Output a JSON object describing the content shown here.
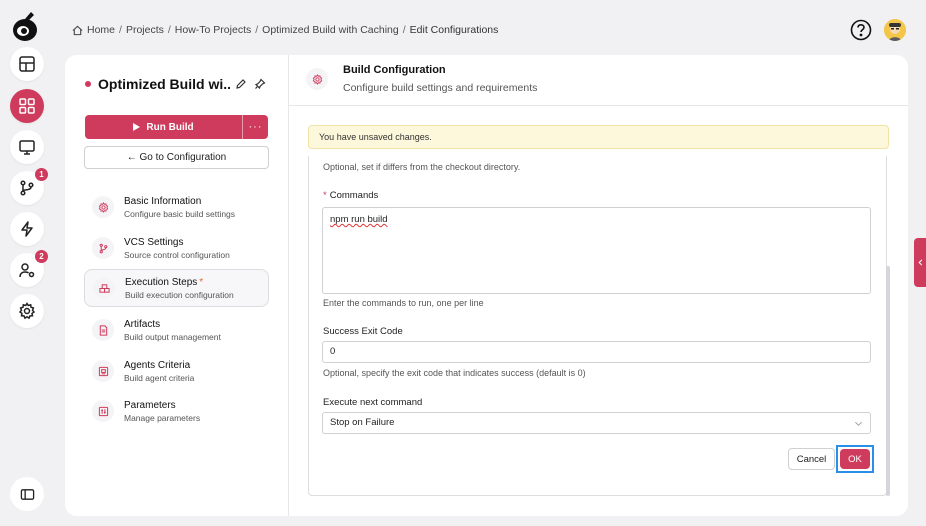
{
  "breadcrumb": {
    "items": [
      "Home",
      "Projects",
      "How-To Projects",
      "Optimized Build with Caching"
    ],
    "current": "Edit Configurations"
  },
  "rail": {
    "items": [
      {
        "icon": "dashboard-icon"
      },
      {
        "icon": "grid-icon",
        "active": true
      },
      {
        "icon": "monitor-icon"
      },
      {
        "icon": "branch-icon",
        "badge": "1"
      },
      {
        "icon": "bolt-icon"
      },
      {
        "icon": "user-gear-icon",
        "badge": "2"
      },
      {
        "icon": "settings-icon"
      }
    ]
  },
  "sidebar": {
    "title": "Optimized Build wi...",
    "run_label": "Run Build",
    "more_label": "···",
    "goto_label": "← Go to Configuration",
    "nav": [
      {
        "title": "Basic Information",
        "subtitle": "Configure basic build settings"
      },
      {
        "title": "VCS Settings",
        "subtitle": "Source control configuration"
      },
      {
        "title": "Execution Steps",
        "subtitle": "Build execution configuration",
        "required": "*"
      },
      {
        "title": "Artifacts",
        "subtitle": "Build output management"
      },
      {
        "title": "Agents Criteria",
        "subtitle": "Build agent criteria"
      },
      {
        "title": "Parameters",
        "subtitle": "Manage parameters"
      }
    ]
  },
  "content": {
    "title": "Build Configuration",
    "subtitle": "Configure build settings and requirements",
    "warning": "You have unsaved changes.",
    "form": {
      "checkout_hint": "Optional, set if differs from the checkout directory.",
      "commands_required": "*",
      "commands_label": "Commands",
      "commands_value": "npm run build",
      "commands_hint": "Enter the commands to run, one per line",
      "exit_code_label": "Success Exit Code",
      "exit_code_value": "0",
      "exit_code_hint": "Optional, specify the exit code that indicates success (default is 0)",
      "next_label": "Execute next command",
      "next_value": "Stop on Failure",
      "cancel_label": "Cancel",
      "ok_label": "OK"
    }
  },
  "colors": {
    "accent": "#cf3b5c",
    "warning_bg": "#fdf8dc",
    "focus_ring": "#2a8fe6"
  }
}
